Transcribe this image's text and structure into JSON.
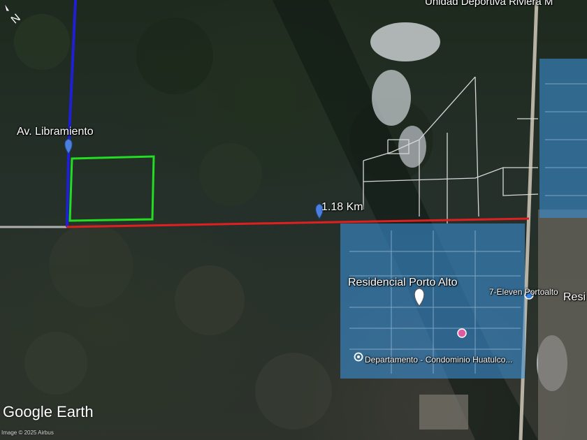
{
  "map": {
    "labels": {
      "av_libramiento": "Av. Libramiento",
      "distance": "1.18 Km",
      "residencial": "Residencial Porto Alto",
      "seven_eleven": "7-Eleven Portoalto",
      "resi_partial": "Resi",
      "departamento": "Departamento -  Condominio Huatulco...",
      "unidad_deportiva": "Unidad Deportiva Riviera M"
    },
    "brand": "Google Earth",
    "credit": "Image © 2025 Airbus",
    "measurement": {
      "distance_km": 1.18
    },
    "colors": {
      "road_line": "#1f1fd6",
      "measure_line": "#e02020",
      "parcel_outline": "#22dd22",
      "zone_fill": "#3b8fd6",
      "pin": "#4a7fe0"
    },
    "icons": [
      "placemark-pin-icon",
      "white-pin-icon",
      "store-icon",
      "shop-icon",
      "location-dot-icon",
      "compass-icon"
    ]
  }
}
